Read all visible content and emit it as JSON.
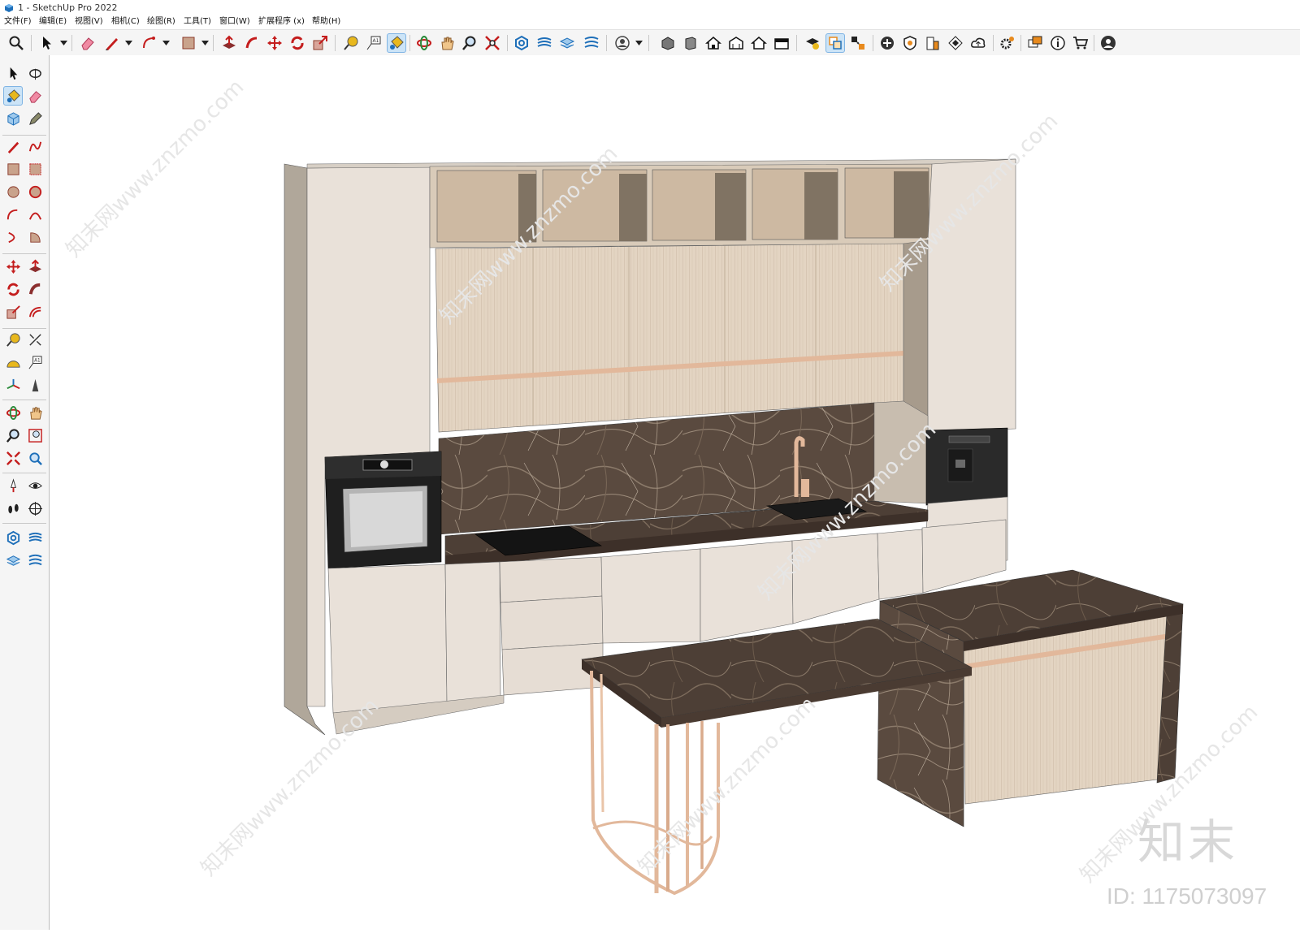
{
  "window": {
    "title": "1 - SketchUp Pro 2022"
  },
  "menu": {
    "file": "文件(F)",
    "edit": "编辑(E)",
    "view": "视图(V)",
    "camera": "相机(C)",
    "draw": "绘图(R)",
    "tools": "工具(T)",
    "window": "窗口(W)",
    "extensions": "扩展程序 (x)",
    "help": "帮助(H)"
  },
  "toolbar_icons": [
    "search-icon",
    "select-arrow-icon",
    "eraser-icon",
    "pencil-line-icon",
    "arc-icon",
    "rectangle-icon",
    "push-pull-icon",
    "follow-me-icon",
    "move-icon",
    "rotate-icon",
    "scale-icon",
    "tape-measure-icon",
    "text-label-icon",
    "paint-bucket-icon",
    "orbit-icon",
    "pan-icon",
    "zoom-icon",
    "zoom-extents-icon",
    "sandbox-icons",
    "user-profile-icon",
    "house-warehouse-icons",
    "layers-icons",
    "extension-icons",
    "info-icon",
    "cart-icon",
    "account-icon"
  ],
  "watermark": {
    "brand": "知末",
    "id": "ID: 1175073097",
    "site_text": "知末网www.znzmo.com"
  },
  "colors": {
    "cabinet_light": "#e8e0d8",
    "cabinet_side": "#b0a79a",
    "oak_panel": "#e2d3c2",
    "marble": "#5b4a3f",
    "rose_gold": "#e2b89b",
    "appliance": "#2a2a2a",
    "active_tool": "#cce4f7"
  }
}
